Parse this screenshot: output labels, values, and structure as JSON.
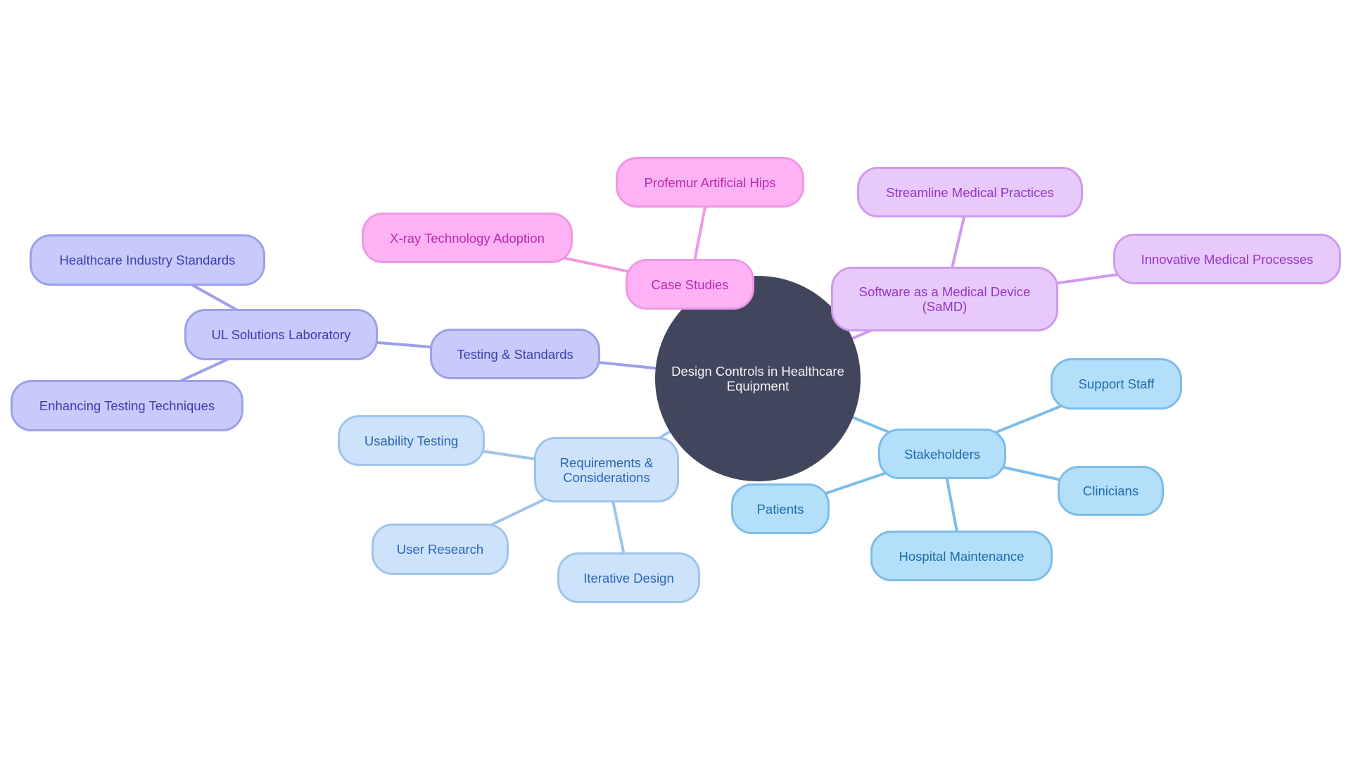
{
  "mindmap": {
    "root": {
      "id": "root",
      "label_line1": "Design Controls in Healthcare",
      "label_line2": "Equipment",
      "color": "#41465c"
    },
    "branch_colors": {
      "case_studies": {
        "fill": "#fdb2f5",
        "stroke": "#ee98e4",
        "text": "#bb2aae"
      },
      "samd": {
        "fill": "#e8c9fb",
        "stroke": "#cf9aee",
        "text": "#9436c8"
      },
      "testing": {
        "fill": "#c9cafc",
        "stroke": "#9ca0ea",
        "text": "#3c3fae"
      },
      "requirements": {
        "fill": "#cde3fb",
        "stroke": "#9ec4ec",
        "text": "#2a64b4"
      },
      "stakeholders": {
        "fill": "#b3dffb",
        "stroke": "#7cbde8",
        "text": "#1f6ba8"
      }
    },
    "nodes": [
      {
        "id": "case_studies",
        "label": "Case Studies",
        "parent": "root",
        "branch": "case_studies"
      },
      {
        "id": "xray",
        "label": "X-ray Technology Adoption",
        "parent": "case_studies",
        "branch": "case_studies"
      },
      {
        "id": "profemur",
        "label": "Profemur Artificial Hips",
        "parent": "case_studies",
        "branch": "case_studies"
      },
      {
        "id": "samd",
        "label": "Software as a Medical Device\n(SaMD)",
        "parent": "root",
        "branch": "samd"
      },
      {
        "id": "streamline",
        "label": "Streamline Medical Practices",
        "parent": "samd",
        "branch": "samd"
      },
      {
        "id": "innovative",
        "label": "Innovative Medical Processes",
        "parent": "samd",
        "branch": "samd"
      },
      {
        "id": "testing",
        "label": "Testing & Standards",
        "parent": "root",
        "branch": "testing"
      },
      {
        "id": "ul",
        "label": "UL Solutions Laboratory",
        "parent": "testing",
        "branch": "testing"
      },
      {
        "id": "healthcare_std",
        "label": "Healthcare Industry Standards",
        "parent": "ul",
        "branch": "testing"
      },
      {
        "id": "enhancing",
        "label": "Enhancing Testing Techniques",
        "parent": "ul",
        "branch": "testing"
      },
      {
        "id": "requirements",
        "label": "Requirements &\nConsiderations",
        "parent": "root",
        "branch": "requirements"
      },
      {
        "id": "usability",
        "label": "Usability Testing",
        "parent": "requirements",
        "branch": "requirements"
      },
      {
        "id": "user_research",
        "label": "User Research",
        "parent": "requirements",
        "branch": "requirements"
      },
      {
        "id": "iterative",
        "label": "Iterative Design",
        "parent": "requirements",
        "branch": "requirements"
      },
      {
        "id": "stakeholders",
        "label": "Stakeholders",
        "parent": "root",
        "branch": "stakeholders"
      },
      {
        "id": "support_staff",
        "label": "Support Staff",
        "parent": "stakeholders",
        "branch": "stakeholders"
      },
      {
        "id": "clinicians",
        "label": "Clinicians",
        "parent": "stakeholders",
        "branch": "stakeholders"
      },
      {
        "id": "patients",
        "label": "Patients",
        "parent": "stakeholders",
        "branch": "stakeholders"
      },
      {
        "id": "hospital_maint",
        "label": "Hospital Maintenance",
        "parent": "stakeholders",
        "branch": "stakeholders"
      }
    ]
  }
}
